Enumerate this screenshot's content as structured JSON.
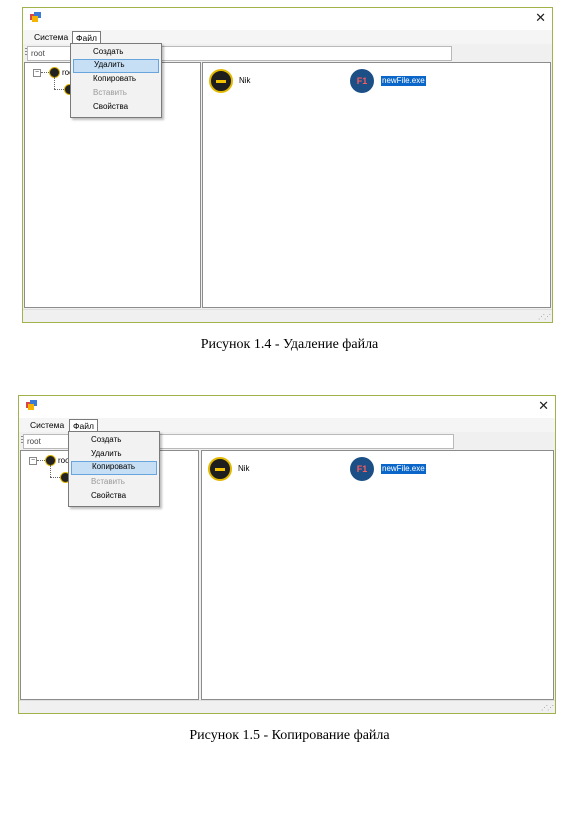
{
  "figures": [
    {
      "window": {
        "close_icon": "close-icon",
        "menu": {
          "system": "Система",
          "file": "Файл"
        },
        "address": "root",
        "tree": {
          "root_label": "root",
          "toggle": "−"
        },
        "items": [
          {
            "icon": "folder-icon",
            "label": "Nik",
            "selected": false
          },
          {
            "icon": "file-icon",
            "icon_text": "F1",
            "label": "newFile.exe",
            "selected": true
          }
        ],
        "dropdown": [
          {
            "label": "Создать",
            "state": "normal"
          },
          {
            "label": "Удалить",
            "state": "highlighted"
          },
          {
            "label": "Копировать",
            "state": "normal"
          },
          {
            "label": "Вставить",
            "state": "disabled"
          },
          {
            "label": "Свойства",
            "state": "normal"
          }
        ]
      },
      "caption": "Рисунок 1.4 - Удаление файла"
    },
    {
      "window": {
        "close_icon": "close-icon",
        "menu": {
          "system": "Система",
          "file": "Файл"
        },
        "address": "root",
        "tree": {
          "root_label": "root",
          "toggle": "−"
        },
        "items": [
          {
            "icon": "folder-icon",
            "label": "Nik",
            "selected": false
          },
          {
            "icon": "file-icon",
            "icon_text": "F1",
            "label": "newFile.exe",
            "selected": true
          }
        ],
        "dropdown": [
          {
            "label": "Создать",
            "state": "normal"
          },
          {
            "label": "Удалить",
            "state": "normal"
          },
          {
            "label": "Копировать",
            "state": "highlighted"
          },
          {
            "label": "Вставить",
            "state": "disabled"
          },
          {
            "label": "Свойства",
            "state": "normal"
          }
        ]
      },
      "caption": "Рисунок 1.5 - Копирование файла"
    }
  ],
  "colors": {
    "selection": "#0a66c9",
    "menu_highlight": "#c6dff5",
    "folder_ring": "#e2b800",
    "file_icon": "#1c4f86"
  }
}
